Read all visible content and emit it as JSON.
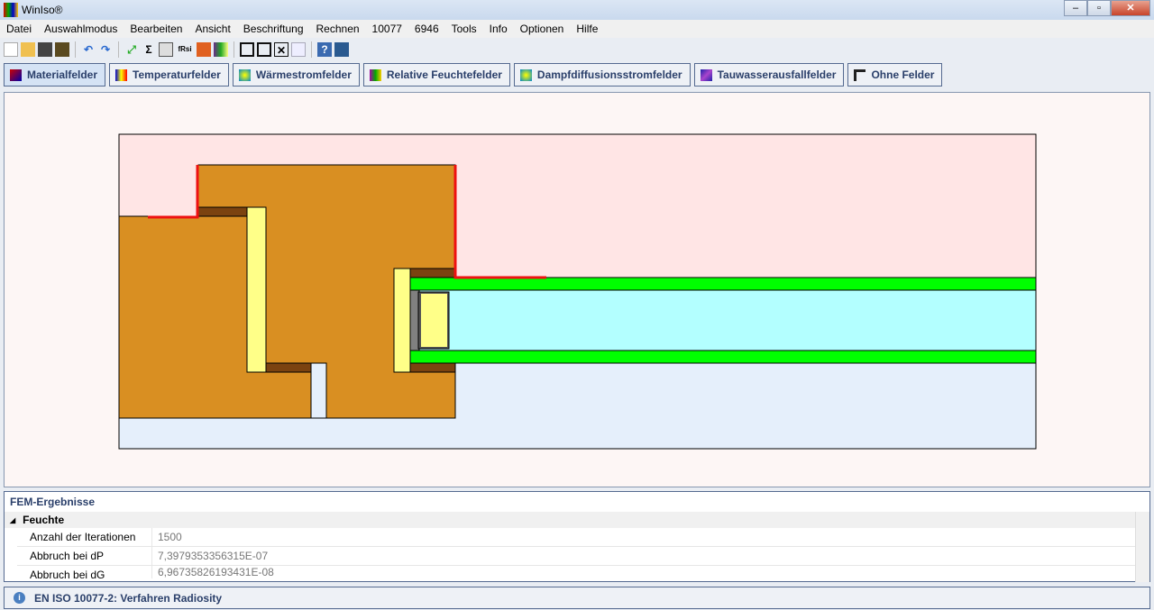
{
  "window": {
    "title": "WinIso®"
  },
  "menu": [
    "Datei",
    "Auswahlmodus",
    "Bearbeiten",
    "Ansicht",
    "Beschriftung",
    "Rechnen",
    "10077",
    "6946",
    "Tools",
    "Info",
    "Optionen",
    "Hilfe"
  ],
  "toolbar": {
    "sum": "Σ",
    "frsi": "fRsi"
  },
  "fields": [
    {
      "label": "Materialfelder",
      "active": true
    },
    {
      "label": "Temperaturfelder"
    },
    {
      "label": "Wärmestromfelder"
    },
    {
      "label": "Relative Feuchtefelder"
    },
    {
      "label": "Dampfdiffusionsstromfelder"
    },
    {
      "label": "Tauwasserausfallfelder"
    },
    {
      "label": "Ohne Felder"
    }
  ],
  "results": {
    "title": "FEM-Ergebnisse",
    "group": "Feuchte",
    "rows": [
      {
        "key": "Anzahl der Iterationen",
        "value": "1500"
      },
      {
        "key": "Abbruch bei dP",
        "value": "7,3979353356315E-07"
      },
      {
        "key": "Abbruch bei dG",
        "value": "6,96735826193431E-08"
      }
    ]
  },
  "status": "EN ISO 10077-2: Verfahren Radiosity",
  "colors": {
    "wood": "#d98f22",
    "darkbrown": "#7b4310",
    "yellow": "#ffff88",
    "green": "#00ff00",
    "glass": "#b3ffff",
    "inside": "#ffe5e5",
    "outside": "#e5effb",
    "boundary": "#ee1111"
  }
}
